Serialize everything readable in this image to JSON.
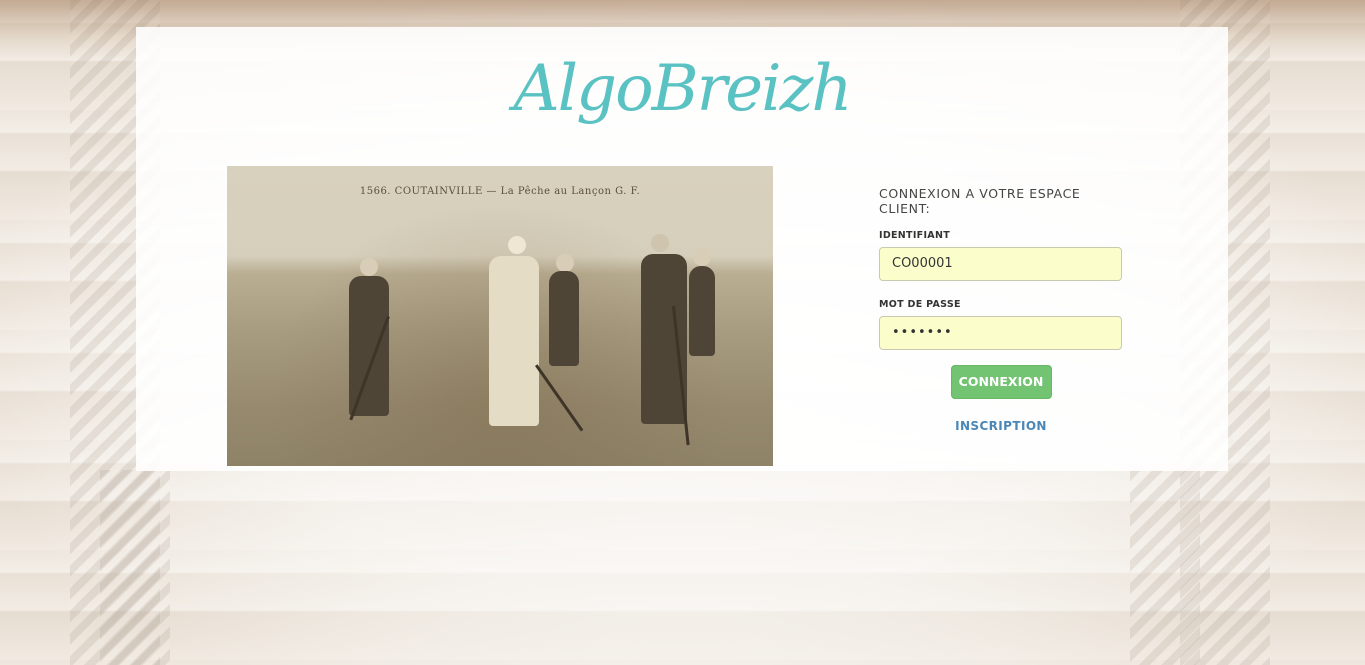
{
  "brand": {
    "logo_text": "AlgoBreizh",
    "accent_color": "#5bc2c3"
  },
  "photo": {
    "caption": "1566. COUTAINVILLE — La Pêche au Lançon   G. F."
  },
  "login": {
    "title": "CONNEXION A VOTRE ESPACE CLIENT:",
    "identifiant_label": "IDENTIFIANT",
    "identifiant_value": "CO00001",
    "password_label": "MOT DE PASSE",
    "password_value": "•••••••",
    "submit_label": "CONNEXION",
    "register_link": "INSCRIPTION",
    "submit_color": "#72c472",
    "link_color": "#4a86b6",
    "field_bg_color": "#fbfecb"
  }
}
